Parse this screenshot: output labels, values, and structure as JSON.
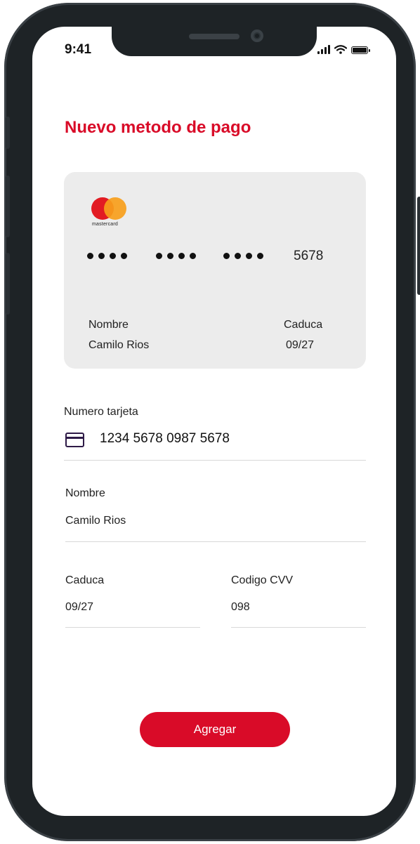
{
  "status_bar": {
    "time": "9:41",
    "icons": [
      "signal-icon",
      "wifi-icon",
      "battery-icon"
    ]
  },
  "page": {
    "title": "Nuevo metodo de pago"
  },
  "card_preview": {
    "brand": "mastercard",
    "brand_colors": {
      "red": "#e21b23",
      "orange": "#f79e1b"
    },
    "masked_groups": [
      "••••",
      "••••",
      "••••"
    ],
    "last4": "5678",
    "name_label": "Nombre",
    "name_value": "Camilo Rios",
    "expiry_label": "Caduca",
    "expiry_value": "09/27"
  },
  "form": {
    "card_number": {
      "label": "Numero tarjeta",
      "value": "1234 5678 0987 5678",
      "icon": "credit-card-icon"
    },
    "name": {
      "label": "Nombre",
      "value": "Camilo Rios"
    },
    "expiry": {
      "label": "Caduca",
      "value": "09/27"
    },
    "cvv": {
      "label": "Codigo CVV",
      "value": "098"
    }
  },
  "actions": {
    "add_label": "Agregar"
  },
  "colors": {
    "accent": "#d90b28",
    "card_bg": "#ececec",
    "icon_dark": "#2e1a47"
  }
}
